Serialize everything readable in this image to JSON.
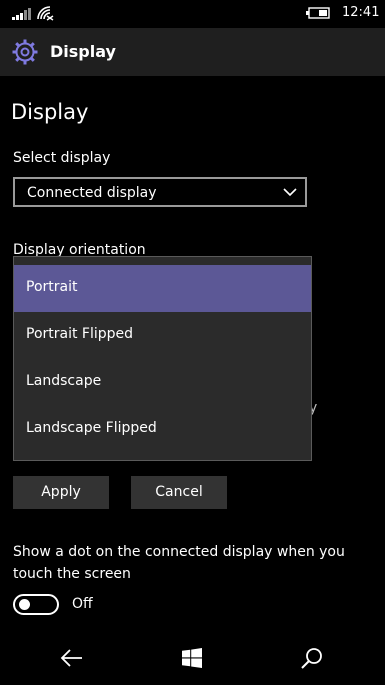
{
  "status": {
    "time": "12:41"
  },
  "header": {
    "title": "Display"
  },
  "page": {
    "title": "Display"
  },
  "select_display": {
    "label": "Select display",
    "value": "Connected display"
  },
  "orientation": {
    "label": "Display orientation",
    "options": [
      "Portrait",
      "Portrait Flipped",
      "Landscape",
      "Landscape Flipped"
    ],
    "selected": "Portrait"
  },
  "buttons": {
    "apply": "Apply",
    "cancel": "Cancel"
  },
  "dot_setting": {
    "label": "Show a dot on the connected display when you touch the screen",
    "state": "Off"
  },
  "colors": {
    "accent": "#5c5896",
    "header_bg": "#1f1f1f",
    "button_bg": "#333333"
  },
  "icons": [
    "signal-icon",
    "wifi-icon",
    "battery-icon",
    "gear-icon",
    "chevron-down-icon",
    "back-icon",
    "windows-icon",
    "search-icon"
  ]
}
